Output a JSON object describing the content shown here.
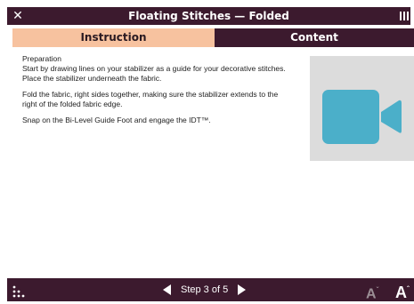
{
  "titlebar": {
    "title": "Floating Stitches — Folded",
    "close_symbol": "✕",
    "close_icon": "close-icon",
    "menu_icon": "menu-icon"
  },
  "tabs": [
    {
      "label": "Instruction",
      "active": true
    },
    {
      "label": "Content",
      "active": false
    }
  ],
  "content": {
    "heading": "Preparation",
    "paragraphs": [
      "Start by drawing lines on your stabilizer as a guide for your decorative stitches. Place the stabilizer underneath the fabric.",
      "Fold the fabric, right sides together, making sure the stabilizer extends to the right of the folded fabric edge.",
      "Snap on the Bi-Level Guide Foot and engage the IDT™."
    ],
    "video_icon": "video-camera-icon"
  },
  "footer": {
    "step_text": "Step 3 of 5",
    "prev_icon": "triangle-left-icon",
    "next_icon": "triangle-right-icon",
    "grid_icon": "grid-dots-icon",
    "font_smaller_label": "A",
    "font_larger_label": "A",
    "font_smaller_mark": "ˇ",
    "font_larger_mark": "ˆ"
  },
  "colors": {
    "bar": "#3c1a2e",
    "active_tab": "#f7c29f",
    "video_icon": "#4bafc9",
    "video_bg": "#dcdcdc"
  }
}
